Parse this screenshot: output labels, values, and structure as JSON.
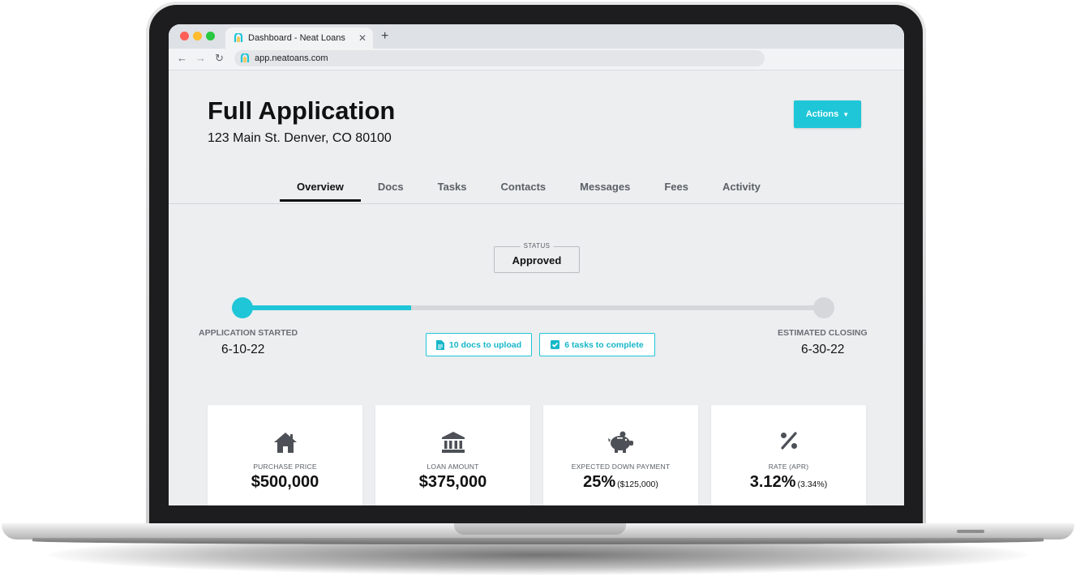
{
  "browser": {
    "tab_title": "Dashboard - Neat Loans",
    "tab_close": "✕",
    "new_tab": "+",
    "url": "app.neatoans.com",
    "back": "←",
    "forward": "→",
    "reload": "↻"
  },
  "header": {
    "title": "Full Application",
    "address": "123 Main St. Denver, CO 80100",
    "actions_label": "Actions"
  },
  "tabs": [
    {
      "label": "Overview",
      "active": true
    },
    {
      "label": "Docs"
    },
    {
      "label": "Tasks"
    },
    {
      "label": "Contacts"
    },
    {
      "label": "Messages"
    },
    {
      "label": "Fees"
    },
    {
      "label": "Activity"
    }
  ],
  "status": {
    "label": "STATUS",
    "value": "Approved"
  },
  "progress": {
    "fraction": 0.29,
    "start_label": "APPLICATION STARTED",
    "start_date": "6-10-22",
    "end_label": "ESTIMATED CLOSING",
    "end_date": "6-30-22"
  },
  "pills": {
    "docs": "10 docs to upload",
    "tasks": "6 tasks to complete"
  },
  "cards": [
    {
      "label": "PURCHASE PRICE",
      "value": "$500,000",
      "sub": "",
      "icon": "house-icon"
    },
    {
      "label": "LOAN AMOUNT",
      "value": "$375,000",
      "sub": "",
      "icon": "bank-icon"
    },
    {
      "label": "EXPECTED DOWN PAYMENT",
      "value": "25%",
      "sub": "($125,000)",
      "icon": "piggy-bank-icon"
    },
    {
      "label": "RATE (APR)",
      "value": "3.12%",
      "sub": "(3.34%)",
      "icon": "percent-icon"
    }
  ],
  "colors": {
    "accent": "#1fc6d8",
    "page_bg": "#eceef0"
  }
}
